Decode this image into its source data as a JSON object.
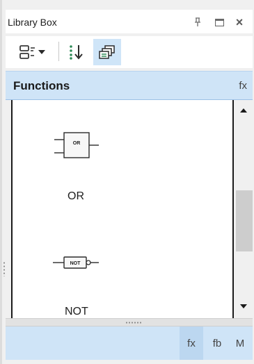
{
  "window": {
    "title": "Library Box",
    "pin_icon": "pin-icon",
    "maximize_icon": "maximize-icon",
    "close_icon": "close-icon",
    "close_glyph": "×"
  },
  "toolbar": {
    "view_mode_icon": "list-view-dropdown-icon",
    "sort_icon": "sort-icon",
    "group_icon": "stacked-library-icon",
    "active_button": "group"
  },
  "section": {
    "title": "Functions",
    "icon_text": "fx"
  },
  "items": [
    {
      "block_text": "OR",
      "label": "OR"
    },
    {
      "block_text": "NOT",
      "label": "NOT"
    }
  ],
  "bottom_tabs": [
    {
      "label": "fx",
      "active": true
    },
    {
      "label": "fb",
      "active": false
    },
    {
      "label": "M",
      "active": false
    }
  ],
  "colors": {
    "accent_light": "#cfe4f7",
    "accent_active": "#cfe5f8",
    "panel_bg": "#f0f0f0"
  }
}
